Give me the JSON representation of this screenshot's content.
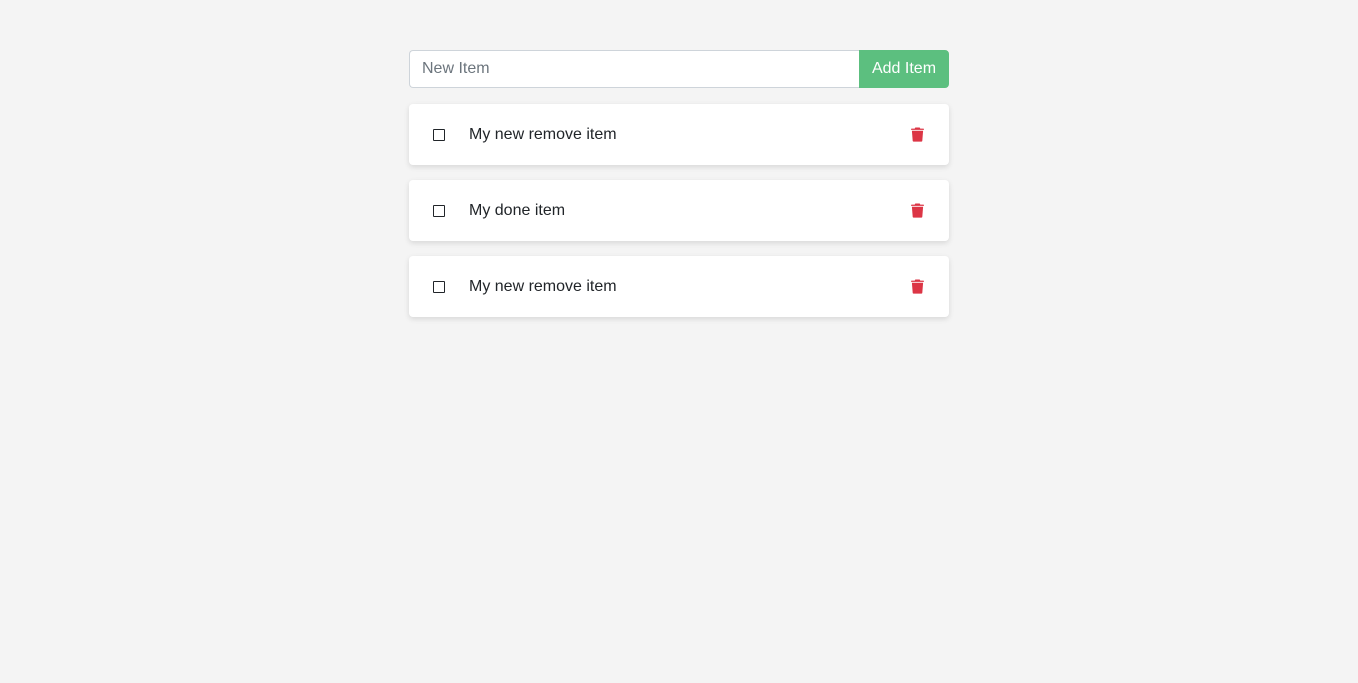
{
  "form": {
    "input_placeholder": "New Item",
    "input_value": "",
    "add_label": "Add Item"
  },
  "items": [
    {
      "name": "My new remove item",
      "complete": false
    },
    {
      "name": "My done item",
      "complete": false
    },
    {
      "name": "My new remove item",
      "complete": false
    }
  ],
  "colors": {
    "background": "#f4f4f4",
    "add_button": "#5cbf7f",
    "trash_icon": "#dc3545"
  },
  "icons": {
    "remove": "trash-icon",
    "checkbox": "unchecked-box"
  }
}
